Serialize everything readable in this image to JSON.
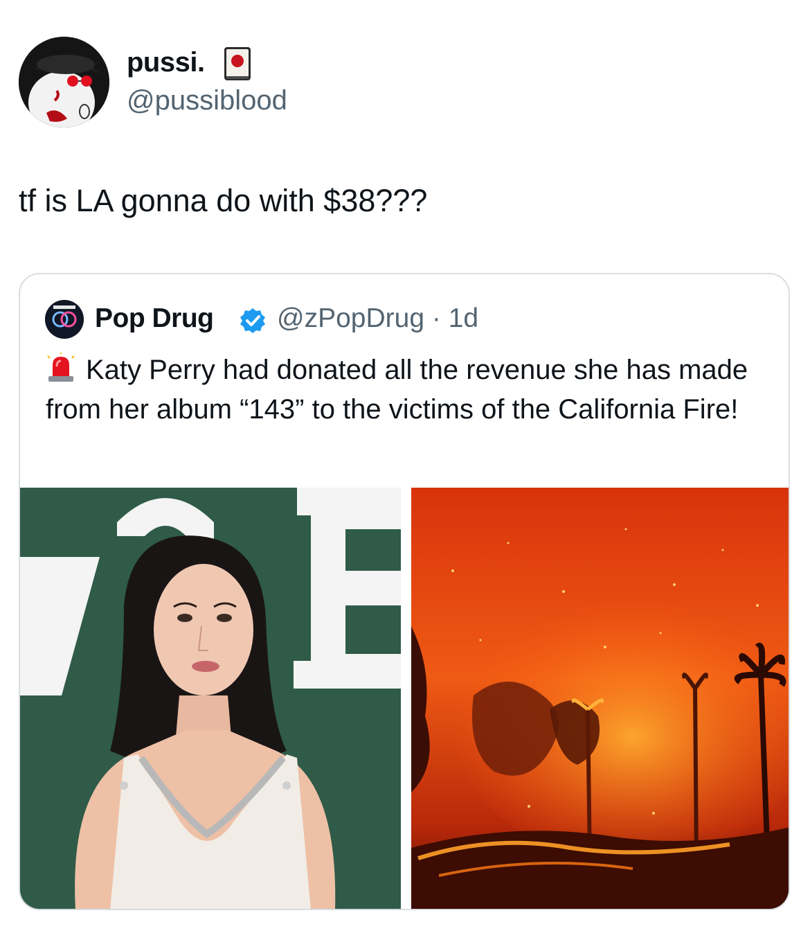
{
  "tweet": {
    "author_name": "pussi.",
    "author_handle": "@pussiblood",
    "text": "tf is LA gonna do with $38???",
    "avatar_icon": "cat-avatar-icon",
    "badge_icon": "mahjong-tile-icon"
  },
  "quote": {
    "author_name": "Pop Drug",
    "author_handle": "@zPopDrug",
    "separator": "·",
    "time": "1d",
    "verified_icon": "verified-badge-icon",
    "siren_icon": "police-siren-icon",
    "text": "Katy Perry had donated all the revenue she has made from her album “143” to the victims of the California Fire!",
    "images": [
      {
        "name": "katy-perry-photo",
        "description_icon": "portrait-photo"
      },
      {
        "name": "california-fire-photo",
        "description_icon": "wildfire-photo"
      }
    ]
  },
  "colors": {
    "text_primary": "#0f1419",
    "text_secondary": "#536471",
    "verified_blue": "#1d9bf0",
    "card_border": "#d9dde1",
    "backdrop_green": "#2f5b48",
    "fire_orange": "#e84812"
  }
}
